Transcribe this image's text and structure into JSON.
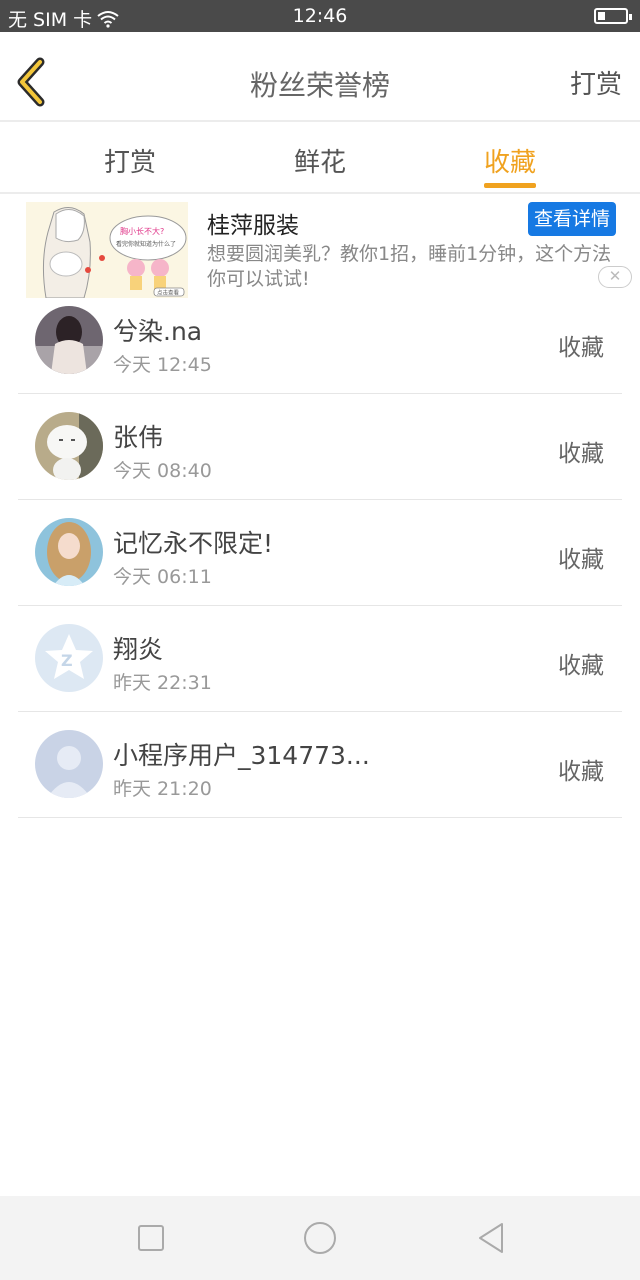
{
  "status_bar": {
    "carrier": "无 SIM 卡",
    "time": "12:46"
  },
  "nav": {
    "title": "粉丝荣誉榜",
    "action": "打赏"
  },
  "tabs": [
    {
      "label": "打赏"
    },
    {
      "label": "鲜花"
    },
    {
      "label": "收藏"
    }
  ],
  "active_tab": "收藏",
  "ad": {
    "title": "桂萍服装",
    "button": "查看详情",
    "description": "想要圆润美乳？教你1招，睡前1分钟，这个方法你可以试试!",
    "image_text_1": "胸小长不大?",
    "image_text_2": "看完你就知道为什么了",
    "image_badge": "点击查看"
  },
  "list": [
    {
      "name": "兮染.na",
      "time": "今天 12:45",
      "action": "收藏"
    },
    {
      "name": "张伟",
      "time": "今天 08:40",
      "action": "收藏"
    },
    {
      "name": "记忆永不限定!",
      "time": "今天 06:11",
      "action": "收藏"
    },
    {
      "name": "翔炎",
      "time": "昨天 22:31",
      "action": "收藏"
    },
    {
      "name": "小程序用户_314773...",
      "time": "昨天 21:20",
      "action": "收藏"
    }
  ],
  "colors": {
    "accent": "#f0a21f",
    "ad_button": "#1679e3",
    "status_bar": "#4a4a4a"
  }
}
